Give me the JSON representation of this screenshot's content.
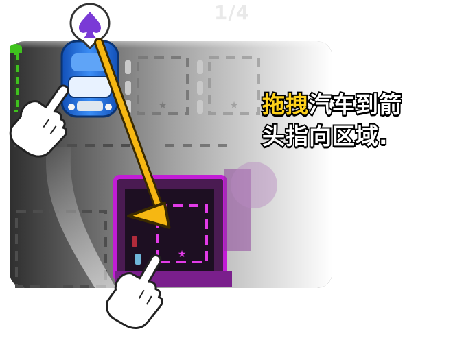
{
  "level_progress": "1/4",
  "instruction": {
    "line1_highlight": "拖拽",
    "line1_rest": "汽车到箭",
    "line2": "头指向区域."
  },
  "car_badge_icon": "spade-icon",
  "colors": {
    "board": "#303030",
    "green_zone": "#3fc21e",
    "purple_zone": "#c21cd6",
    "car_body": "#1f6fe0",
    "arrow": "#f6b712",
    "highlight_text": "#ffd21a"
  }
}
